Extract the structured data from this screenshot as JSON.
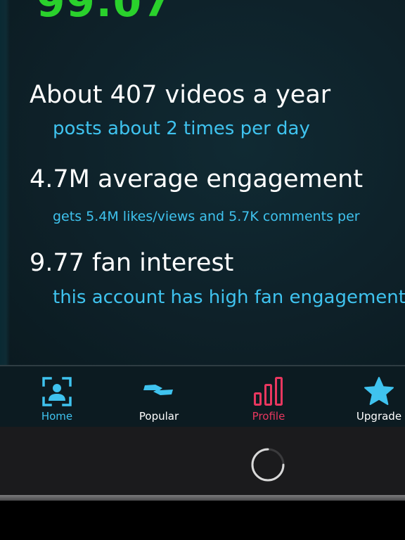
{
  "stats": {
    "score": "99.07",
    "videos_title": "About 407 videos a year",
    "videos_sub": "posts about 2 times per day",
    "engagement_title": "4.7M average engagement",
    "engagement_sub": "gets 5.4M likes/views and 5.7K comments per",
    "fan_title": "9.77 fan interest",
    "fan_sub": "this account has high fan engagement"
  },
  "tabs": [
    {
      "label": "Home",
      "icon": "home-icon",
      "color": "#3fc3ef"
    },
    {
      "label": "Popular",
      "icon": "lightning-icon",
      "color": "#ffffff"
    },
    {
      "label": "Profile",
      "icon": "bar-chart-icon",
      "color": "#e8375f"
    },
    {
      "label": "Upgrade",
      "icon": "star-icon",
      "color": "#ffffff"
    }
  ],
  "colors": {
    "accent_blue": "#3fc3ef",
    "accent_green": "#2ad12c",
    "accent_pink": "#e8375f",
    "background": "#0e2129"
  }
}
